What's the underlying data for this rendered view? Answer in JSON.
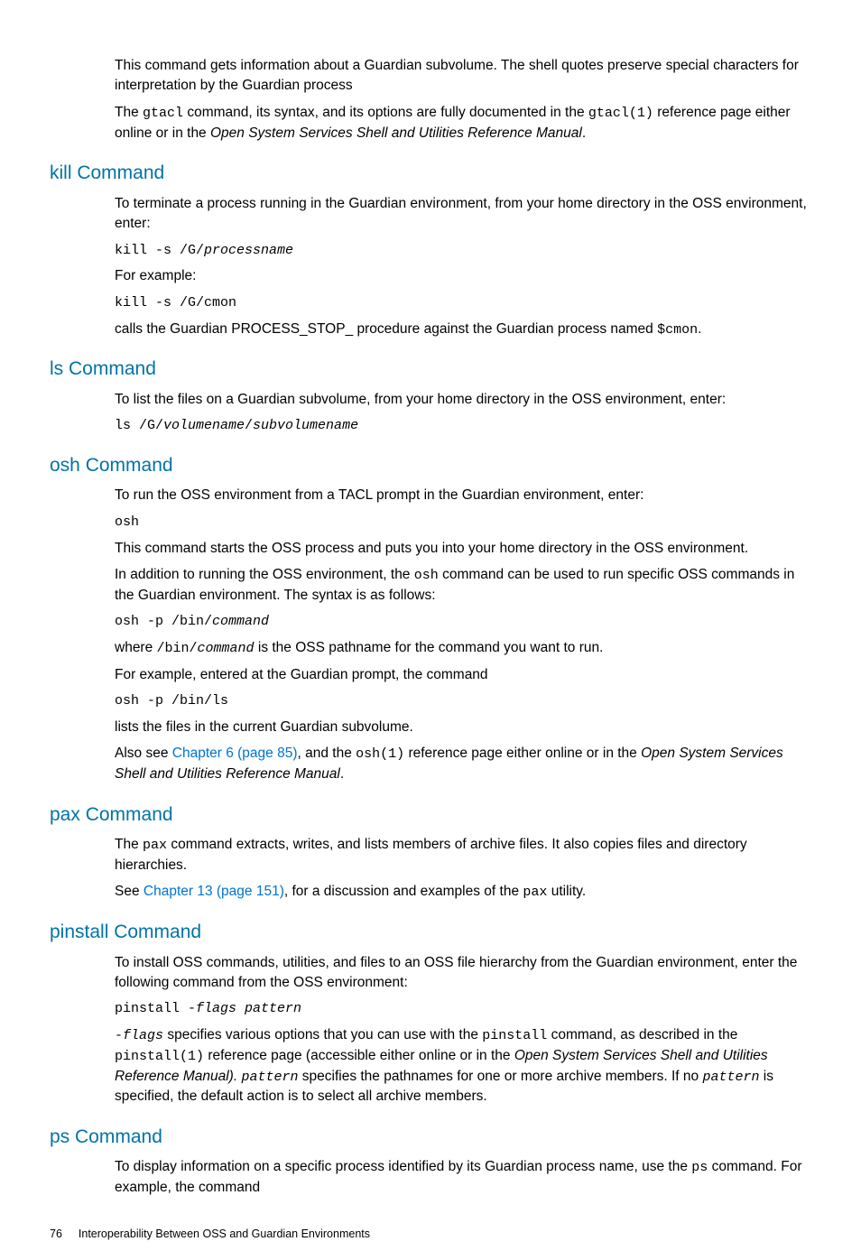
{
  "intro": {
    "p1": "This command gets information about a Guardian subvolume. The shell quotes preserve special characters for interpretation by the Guardian process",
    "p2a": "The ",
    "p2b": "gtacl",
    "p2c": " command, its syntax, and its options are fully documented in the ",
    "p2d": "gtacl(1)",
    "p2e": " reference page either online or in the ",
    "p2f": "Open System Services Shell and Utilities Reference Manual",
    "p2g": "."
  },
  "kill": {
    "heading": "kill Command",
    "p1": "To terminate a process running in the Guardian environment, from your home directory in the OSS environment, enter:",
    "code1a": "kill -s /G/",
    "code1b": "processname",
    "p2": "For example:",
    "code2": "kill -s /G/cmon",
    "p3a": "calls the Guardian PROCESS_STOP_ procedure against the Guardian process named ",
    "p3b": "$cmon",
    "p3c": "."
  },
  "ls": {
    "heading": "ls Command",
    "p1": "To list the files on a Guardian subvolume, from your home directory in the OSS environment, enter:",
    "code1a": "ls /G/",
    "code1b": "volumename",
    "code1c": "/",
    "code1d": "subvolumename"
  },
  "osh": {
    "heading": "osh Command",
    "p1": "To run the OSS environment from a TACL prompt in the Guardian environment, enter:",
    "code1": "osh",
    "p2": "This command starts the OSS process and puts you into your home directory in the OSS environment.",
    "p3a": "In addition to running the OSS environment, the ",
    "p3b": "osh",
    "p3c": " command can be used to run specific OSS commands in the Guardian environment. The syntax is as follows:",
    "code2a": "osh -p /bin/",
    "code2b": "command",
    "p4a": "where ",
    "p4b": "/bin/",
    "p4c": "command",
    "p4d": " is the OSS pathname for the command you want to run.",
    "p5": "For example, entered at the Guardian prompt, the command",
    "code3": "osh -p /bin/ls",
    "p6": "lists the files in the current Guardian subvolume.",
    "p7a": "Also see ",
    "p7link": "Chapter 6 (page 85)",
    "p7b": ", and the ",
    "p7c": "osh(1)",
    "p7d": " reference page either online or in the ",
    "p7e": "Open System Services Shell and Utilities Reference Manual",
    "p7f": "."
  },
  "pax": {
    "heading": "pax Command",
    "p1a": "The ",
    "p1b": "pax",
    "p1c": " command extracts, writes, and lists members of archive files. It also copies files and directory hierarchies.",
    "p2a": "See ",
    "p2link": "Chapter 13 (page 151)",
    "p2b": ", for a discussion and examples of the ",
    "p2c": "pax",
    "p2d": " utility."
  },
  "pinstall": {
    "heading": "pinstall Command",
    "p1": "To install OSS commands, utilities, and files to an OSS file hierarchy from the Guardian environment, enter the following command from the OSS environment:",
    "code1a": "pinstall -",
    "code1b": "flags pattern",
    "p2a": "-flags",
    "p2b": " specifies various options that you can use with the ",
    "p2c": "pinstall",
    "p2d": " command, as described in the ",
    "p2e": "pinstall(1)",
    "p2f": " reference page (accessible either online or in the ",
    "p2g": "Open System Services Shell and Utilities Reference Manual). ",
    "p2h": "pattern",
    "p2i": " specifies the pathnames for one or more archive members. If no ",
    "p2j": "pattern",
    "p2k": " is specified, the default action is to select all archive members."
  },
  "ps": {
    "heading": "ps Command",
    "p1a": "To display information on a specific process identified by its Guardian process name, use the ",
    "p1b": "ps",
    "p1c": " command. For example, the command"
  },
  "footer": {
    "pageNum": "76",
    "title": "Interoperability Between OSS and Guardian Environments"
  }
}
